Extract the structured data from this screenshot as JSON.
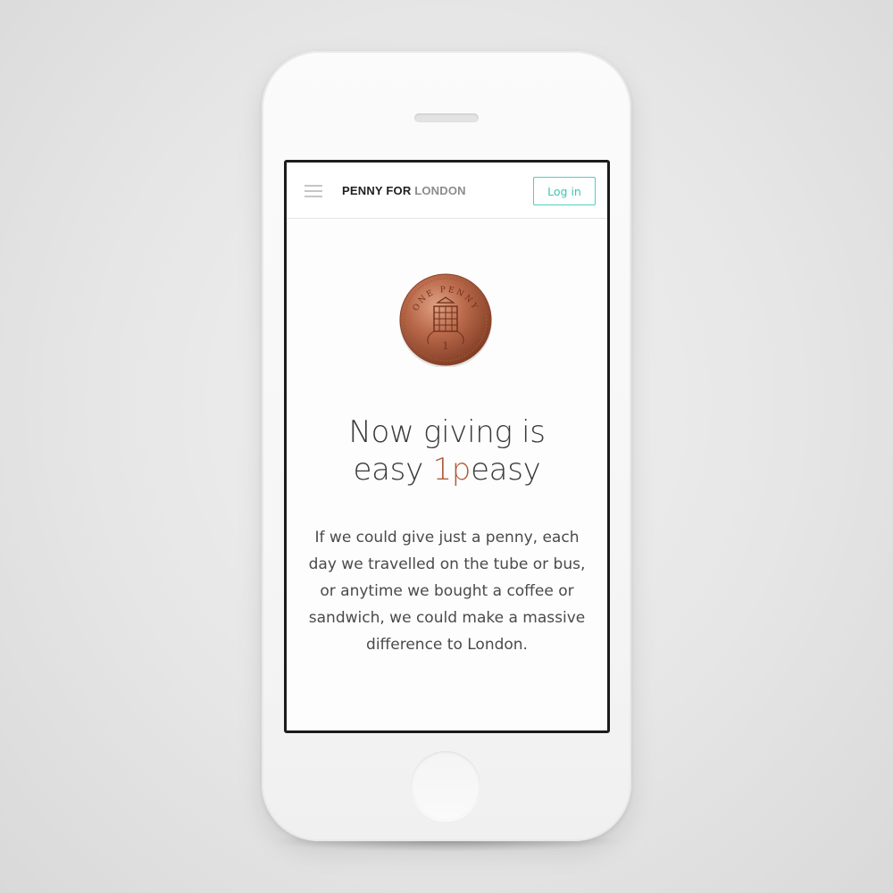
{
  "brand": {
    "part1": "PENNY FOR",
    "part2": "LONDON"
  },
  "header": {
    "login_label": "Log in"
  },
  "coin": {
    "top_text": "ONE PENNY",
    "denomination": "1"
  },
  "hero": {
    "headline_line1": "Now giving is",
    "headline_line2_prefix": "easy ",
    "headline_accent": "1p",
    "headline_line2_suffix": "easy",
    "body": "If we could give just a penny, each day we travelled on the tube or bus, or anytime we bought a coffee or sandwich, we could make a massive difference to London."
  },
  "colors": {
    "accent_copper": "#b05b3b",
    "login_teal": "#3fc3b8",
    "text_dark": "#3a3a3a"
  },
  "icons": [
    "hamburger-menu-icon",
    "penny-coin-icon"
  ]
}
